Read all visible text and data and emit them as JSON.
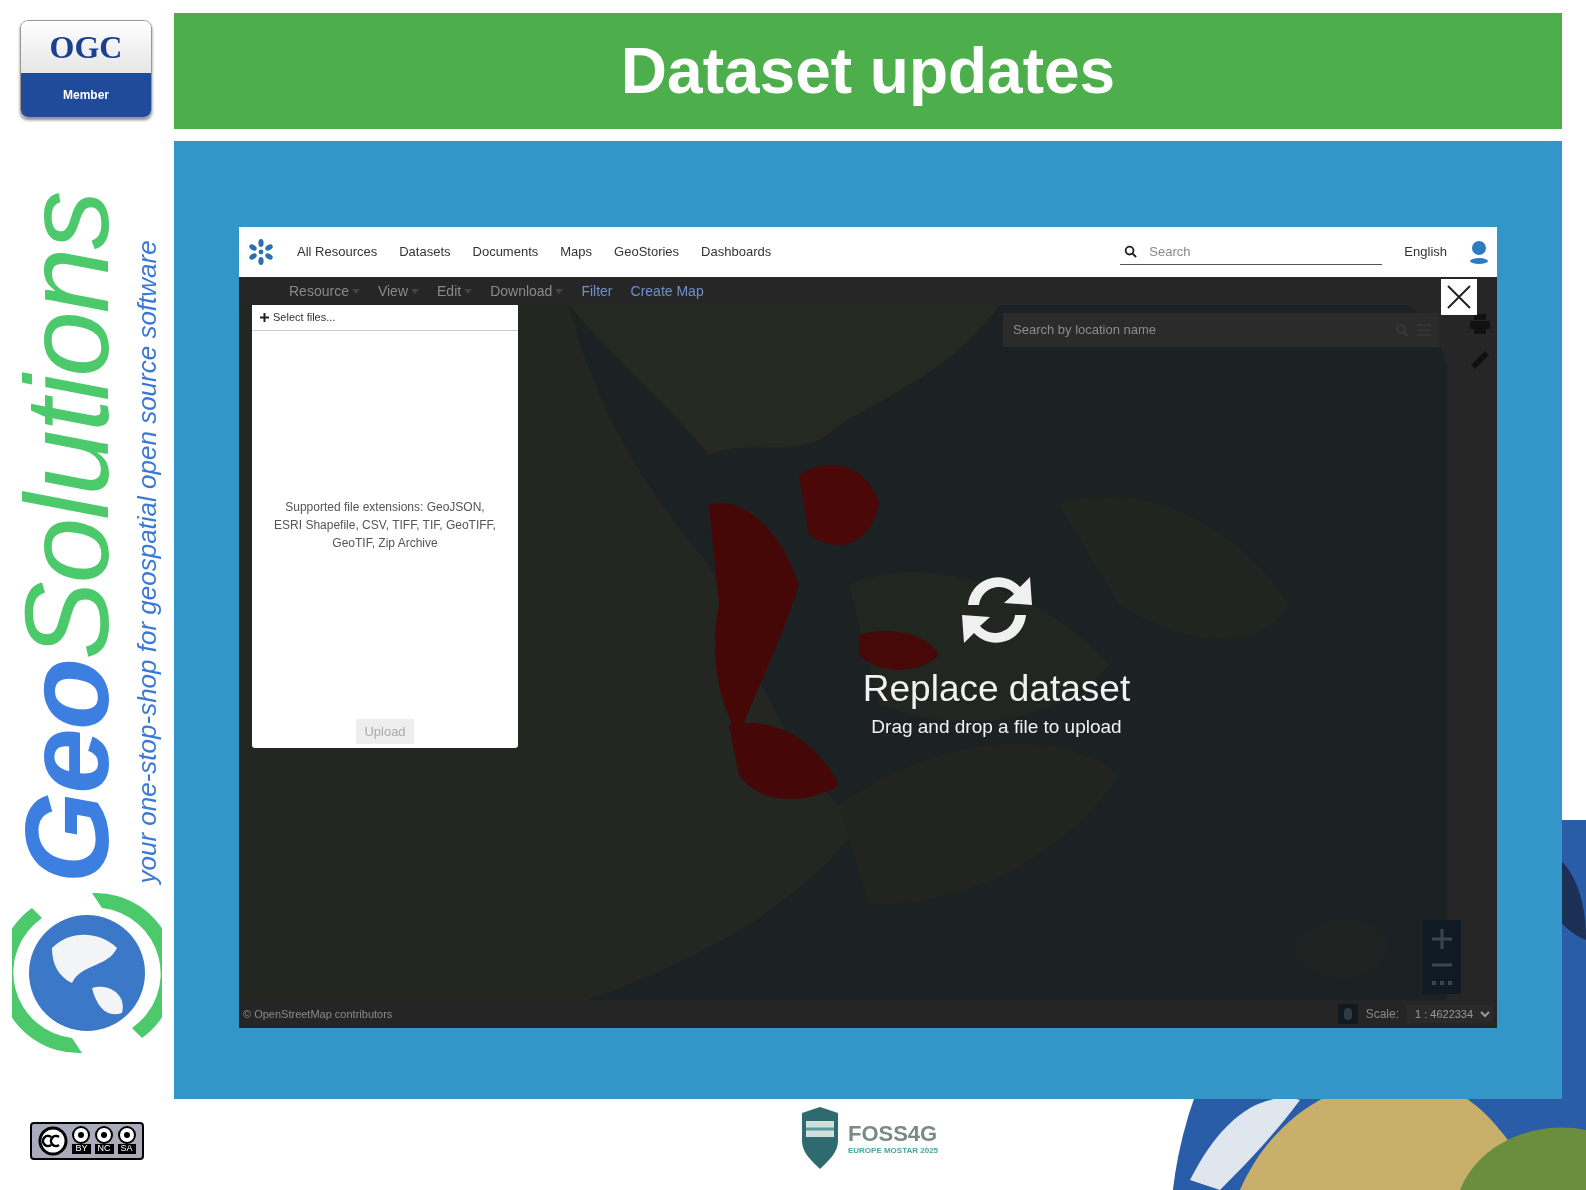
{
  "slide": {
    "title": "Dataset updates"
  },
  "branding": {
    "ogc": {
      "name": "OGC",
      "label": "Member"
    },
    "company": {
      "name_first": "Geo",
      "name_second": "Solutions",
      "tagline": "your one-stop-shop for geospatial open source software"
    },
    "license": {
      "terms": [
        "BY",
        "NC",
        "SA"
      ]
    },
    "conference": {
      "name": "FOSS4G",
      "edition": "EUROPE MOSTAR 2025"
    }
  },
  "app": {
    "nav": {
      "items": [
        {
          "label": "All Resources"
        },
        {
          "label": "Datasets"
        },
        {
          "label": "Documents"
        },
        {
          "label": "Maps"
        },
        {
          "label": "GeoStories"
        },
        {
          "label": "Dashboards"
        }
      ],
      "search": {
        "placeholder": "Search"
      },
      "language": "English"
    },
    "toolbar": {
      "items": [
        {
          "label": "Resource",
          "kind": "menu"
        },
        {
          "label": "View",
          "kind": "menu"
        },
        {
          "label": "Edit",
          "kind": "menu"
        },
        {
          "label": "Download",
          "kind": "menu"
        },
        {
          "label": "Filter",
          "kind": "link"
        },
        {
          "label": "Create Map",
          "kind": "link"
        }
      ]
    },
    "location_search": {
      "placeholder": "Search by location name"
    },
    "upload_panel": {
      "select_label": "Select files...",
      "description": "Supported file extensions: GeoJSON, ESRI Shapefile, CSV, TIFF, TIF, GeoTIFF, GeoTIF, Zip Archive",
      "upload_button": {
        "label": "Upload",
        "disabled": true
      }
    },
    "drop_overlay": {
      "title": "Replace dataset",
      "subtitle": "Drag and drop a file to upload"
    },
    "footer": {
      "attribution": "© OpenStreetMap contributors",
      "scale_label": "Scale:",
      "scale_value": "1 : 4622334"
    }
  }
}
